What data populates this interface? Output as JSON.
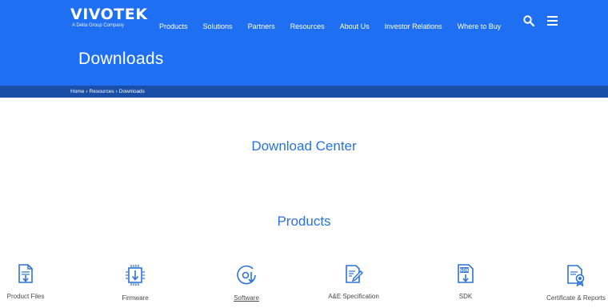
{
  "header": {
    "logo_text": "VIVOTEK",
    "logo_sub": "A Delta Group Company",
    "nav": [
      "Products",
      "Solutions",
      "Partners",
      "Resources",
      "About Us",
      "Investor Relations",
      "Where to Buy"
    ],
    "icons": [
      "search-icon",
      "menu-icon"
    ],
    "page_title": "Downloads",
    "brand_color": "#1f6ff2"
  },
  "breadcrumb": [
    "Home",
    "Resources",
    "Downloads"
  ],
  "main": {
    "download_center_title": "Download Center",
    "products_title": "Products",
    "accent_color": "#2c73d6",
    "categories": [
      {
        "label": "Product Files",
        "icon": "document-download-icon"
      },
      {
        "label": "Firmware",
        "icon": "chip-download-icon"
      },
      {
        "label": "Software",
        "icon": "disc-download-icon"
      },
      {
        "label": "A&E Specification",
        "icon": "document-edit-icon"
      },
      {
        "label": "SDK",
        "icon": "sdk-download-icon"
      },
      {
        "label": "Certificate & Reports",
        "icon": "certificate-icon"
      }
    ]
  }
}
